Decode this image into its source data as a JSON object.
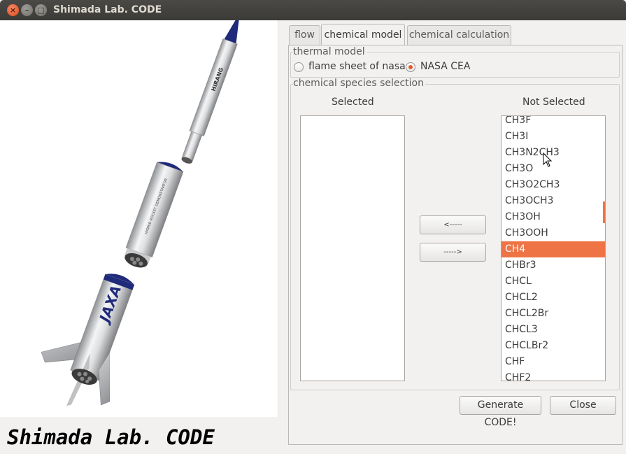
{
  "window": {
    "title": "Shimada Lab. CODE",
    "controls": {
      "close": "×",
      "minimize": "–",
      "maximize": "□"
    }
  },
  "left": {
    "rocket_labels": {
      "nosecone": "HIRANG",
      "body": "HYBRID ROCKET DEMONSTRATOR",
      "logo": "JAXA"
    },
    "brand": "Shimada Lab. CODE"
  },
  "tabs": [
    {
      "label": "flow",
      "active": false
    },
    {
      "label": "chemical model",
      "active": true
    },
    {
      "label": "chemical calculation",
      "active": false
    }
  ],
  "thermal_model": {
    "title": "thermal model",
    "options": [
      {
        "label": "flame sheet of nasa",
        "checked": false
      },
      {
        "label": "NASA CEA",
        "checked": true
      }
    ]
  },
  "species": {
    "title": "chemical species selection",
    "selected_label": "Selected",
    "not_selected_label": "Not Selected",
    "selected_items": [],
    "not_selected_items": [
      "CH3F",
      "CH3I",
      "CH3N2CH3",
      "CH3O",
      "CH3O2CH3",
      "CH3OCH3",
      "CH3OH",
      "CH3OOH",
      "CH4",
      "CHBr3",
      "CHCL",
      "CHCL2",
      "CHCL2Br",
      "CHCL3",
      "CHCLBr2",
      "CHF",
      "CHF2"
    ],
    "highlighted_item": "CH4",
    "move_left_label": "<-----",
    "move_right_label": "----->"
  },
  "actions": {
    "generate_label": "Generate CODE!",
    "close_label": "Close"
  },
  "colors": {
    "accent": "#ee7446",
    "titlebar": "#3c3b37",
    "rocket_blue": "#1f2a7a"
  }
}
